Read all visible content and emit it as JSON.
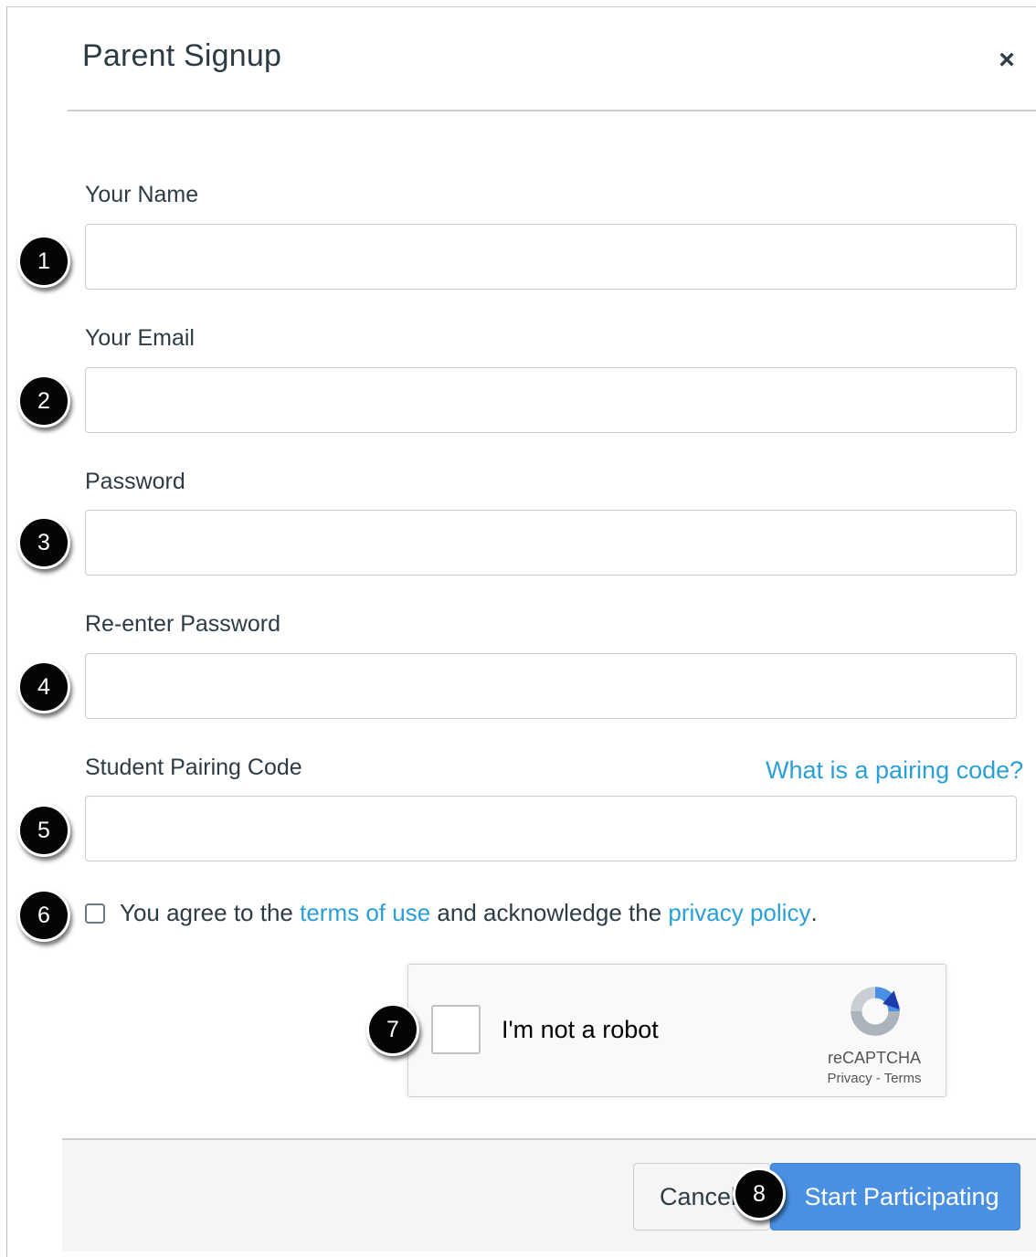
{
  "dialog": {
    "title": "Parent Signup",
    "close_label": "×"
  },
  "form": {
    "name_label": "Your Name",
    "name_value": "",
    "email_label": "Your Email",
    "email_value": "",
    "password_label": "Password",
    "password_value": "",
    "reenter_label": "Re-enter Password",
    "reenter_value": "",
    "pairing_label": "Student Pairing Code",
    "pairing_value": "",
    "pairing_help_link": "What is a pairing code?",
    "agree": {
      "prefix": "You agree to the",
      "terms_link": "terms of use",
      "middle": "and acknowledge the",
      "privacy_link": "privacy policy",
      "suffix": ".",
      "checked": false
    }
  },
  "recaptcha": {
    "label": "I'm not a robot",
    "brand": "reCAPTCHA",
    "links": "Privacy - Terms",
    "checked": false
  },
  "footer": {
    "cancel_label": "Cancel",
    "submit_label": "Start Participating"
  },
  "markers": [
    "1",
    "2",
    "3",
    "4",
    "5",
    "6",
    "7",
    "8"
  ],
  "colors": {
    "link": "#2a9fd6",
    "primary_button": "#4a90e2",
    "text": "#2d3b45",
    "border": "#c7cdd1",
    "footer_bg": "#f5f5f5",
    "marker_bg": "#050505"
  }
}
